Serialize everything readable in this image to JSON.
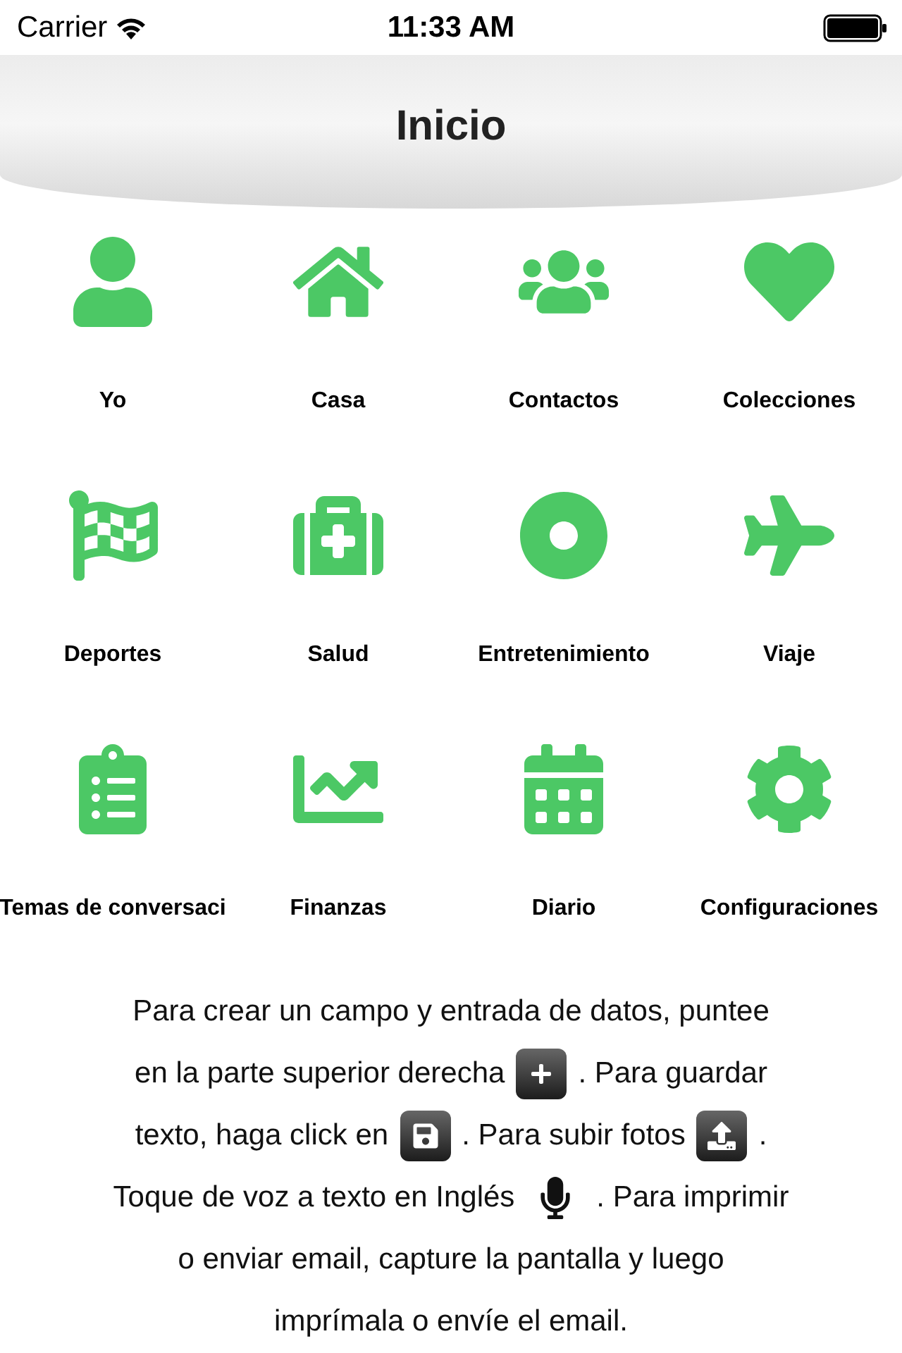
{
  "status_bar": {
    "carrier": "Carrier",
    "time": "11:33 AM"
  },
  "nav": {
    "title": "Inicio"
  },
  "grid": [
    {
      "label": "Yo"
    },
    {
      "label": "Casa"
    },
    {
      "label": "Contactos"
    },
    {
      "label": "Colecciones"
    },
    {
      "label": "Deportes"
    },
    {
      "label": "Salud"
    },
    {
      "label": "Entretenimiento"
    },
    {
      "label": "Viaje"
    },
    {
      "label": "Temas de conversaci"
    },
    {
      "label": "Finanzas"
    },
    {
      "label": "Diario"
    },
    {
      "label": "Configuraciones"
    }
  ],
  "instructions": [
    [
      {
        "kind": "text",
        "text": "Para crear un campo y entrada de datos, puntee"
      }
    ],
    [
      {
        "kind": "text",
        "text": "en la parte superior derecha"
      },
      {
        "kind": "plus"
      },
      {
        "kind": "text",
        "text": ". Para guardar"
      }
    ],
    [
      {
        "kind": "text",
        "text": "texto, haga click en"
      },
      {
        "kind": "save"
      },
      {
        "kind": "text",
        "text": ". Para subir fotos"
      },
      {
        "kind": "upload"
      },
      {
        "kind": "text",
        "text": "."
      }
    ],
    [
      {
        "kind": "text",
        "text": "Toque de voz a texto en Inglés"
      },
      {
        "kind": "mic"
      },
      {
        "kind": "text",
        "text": ". Para imprimir"
      }
    ],
    [
      {
        "kind": "text",
        "text": "o enviar email, capture la pantalla y luego"
      }
    ],
    [
      {
        "kind": "text",
        "text": "imprímala o envíe el email."
      }
    ]
  ]
}
